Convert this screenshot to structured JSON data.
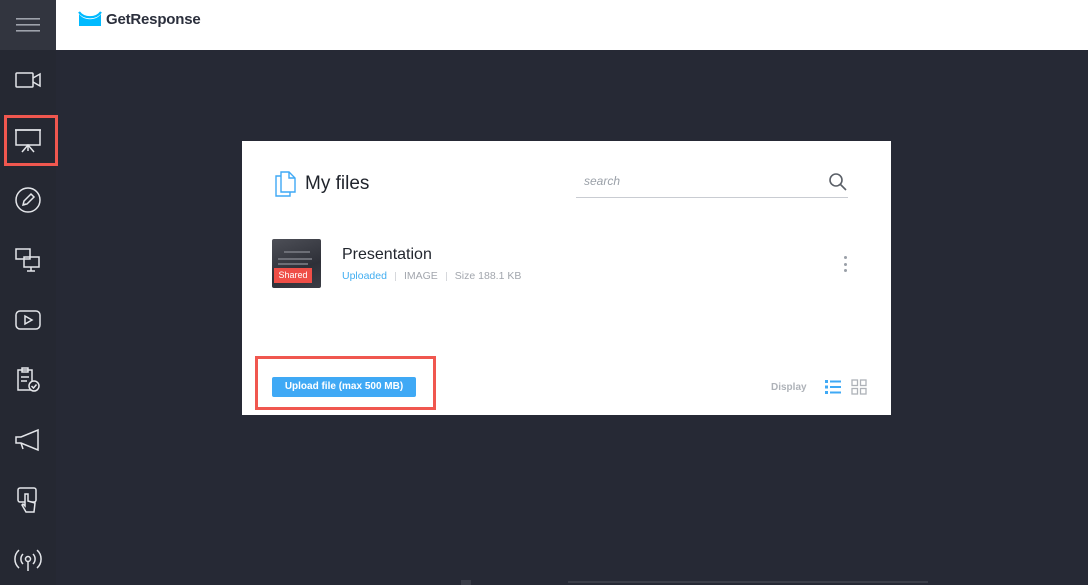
{
  "app": {
    "brand_name": "GetResponse",
    "brand_color": "#00baff"
  },
  "sidebar": {
    "menu_icon": "hamburger-icon",
    "items": [
      {
        "name": "video-camera-icon",
        "active": false
      },
      {
        "name": "presentation-board-icon",
        "active": true
      },
      {
        "name": "pencil-icon",
        "active": false
      },
      {
        "name": "screen-share-icon",
        "active": false
      },
      {
        "name": "play-video-icon",
        "active": false
      },
      {
        "name": "clipboard-check-icon",
        "active": false
      },
      {
        "name": "megaphone-icon",
        "active": false
      },
      {
        "name": "touch-pointer-icon",
        "active": false
      },
      {
        "name": "broadcast-icon",
        "active": false
      }
    ],
    "highlight_color": "#f0574f"
  },
  "dialog": {
    "title": "My files",
    "search": {
      "placeholder": "search",
      "value": ""
    },
    "files": [
      {
        "name": "Presentation",
        "badge": "Shared",
        "status": "Uploaded",
        "type": "IMAGE",
        "size": "Size 188.1 KB"
      }
    ],
    "upload_button": "Upload file (max 500 MB)",
    "display_label": "Display",
    "view_modes": [
      {
        "name": "list-view-icon",
        "active": true
      },
      {
        "name": "grid-view-icon",
        "active": false
      }
    ],
    "accent_color": "#3fa9f5"
  }
}
